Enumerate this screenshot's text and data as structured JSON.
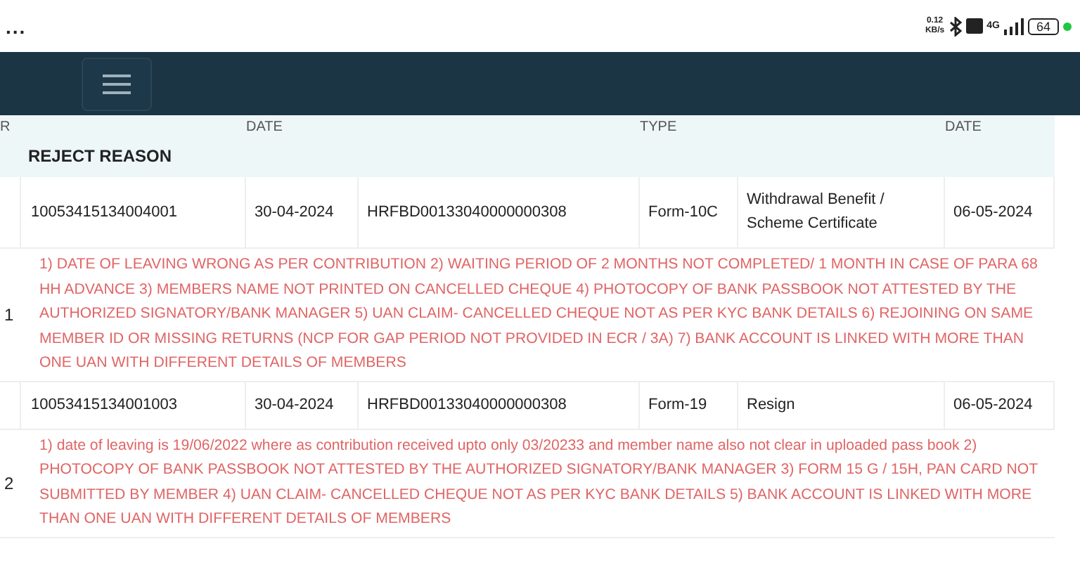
{
  "status_bar": {
    "menu": "...",
    "speed": "0.12",
    "speed_unit": "KB/s",
    "network": "4G",
    "battery": "64"
  },
  "table": {
    "index_header": "R",
    "columns": [
      "",
      "DATE",
      "",
      "TYPE",
      "",
      "DATE"
    ],
    "subheader": "REJECT REASON",
    "rows": [
      {
        "index": "1",
        "cells": [
          "10053415134004001",
          "30-04-2024",
          "HRFBD00133040000000308",
          "Form-10C",
          "Withdrawal Benefit / Scheme Certificate",
          "06-05-2024"
        ],
        "reason": "1) DATE OF LEAVING WRONG AS PER CONTRIBUTION 2) WAITING PERIOD OF 2 MONTHS NOT COMPLETED/ 1 MONTH IN CASE OF PARA 68 HH ADVANCE 3) MEMBERS NAME NOT PRINTED ON CANCELLED CHEQUE 4) PHOTOCOPY OF BANK PASSBOOK NOT ATTESTED BY THE AUTHORIZED SIGNATORY/BANK MANAGER 5) UAN CLAIM- CANCELLED CHEQUE NOT AS PER KYC BANK DETAILS 6) REJOINING ON SAME MEMBER ID OR MISSING RETURNS (NCP FOR GAP PERIOD NOT PROVIDED IN ECR / 3A) 7) BANK ACCOUNT IS LINKED WITH MORE THAN ONE UAN WITH DIFFERENT DETAILS OF MEMBERS"
      },
      {
        "index": "2",
        "cells": [
          "10053415134001003",
          "30-04-2024",
          "HRFBD00133040000000308",
          "Form-19",
          "Resign",
          "06-05-2024"
        ],
        "reason": "1) date of leaving is 19/06/2022 where as contribution received upto only 03/20233 and member name also not clear in uploaded pass book 2) PHOTOCOPY OF BANK PASSBOOK NOT ATTESTED BY THE AUTHORIZED SIGNATORY/BANK MANAGER 3) FORM 15 G / 15H, PAN CARD NOT SUBMITTED BY MEMBER 4) UAN CLAIM- CANCELLED CHEQUE NOT AS PER KYC BANK DETAILS 5) BANK ACCOUNT IS LINKED WITH MORE THAN ONE UAN WITH DIFFERENT DETAILS OF MEMBERS"
      }
    ]
  }
}
